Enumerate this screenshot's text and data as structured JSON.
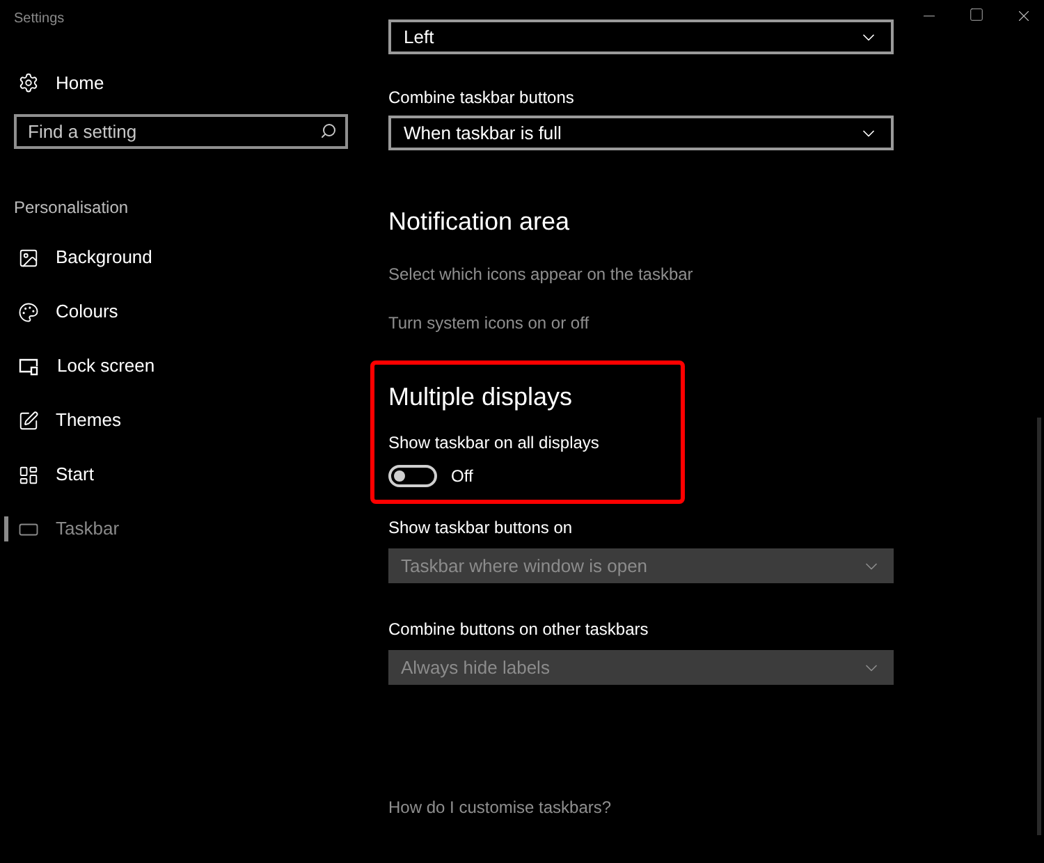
{
  "window": {
    "title": "Settings"
  },
  "sidebar": {
    "home": "Home",
    "search": {
      "placeholder": "Find a setting"
    },
    "section": "Personalisation",
    "items": [
      {
        "label": "Background",
        "kind": "image",
        "selected": false
      },
      {
        "label": "Colours",
        "kind": "palette",
        "selected": false
      },
      {
        "label": "Lock screen",
        "kind": "lock",
        "selected": false
      },
      {
        "label": "Themes",
        "kind": "themes",
        "selected": false
      },
      {
        "label": "Start",
        "kind": "start",
        "selected": false
      },
      {
        "label": "Taskbar",
        "kind": "taskbar",
        "selected": true
      }
    ]
  },
  "content": {
    "top_dropdown": {
      "value": "Left",
      "disabled": false
    },
    "combine": {
      "label": "Combine taskbar buttons",
      "value": "When taskbar is full",
      "disabled": false
    },
    "notification": {
      "heading": "Notification area",
      "links": [
        "Select which icons appear on the taskbar",
        "Turn system icons on or off"
      ]
    },
    "multiple": {
      "heading": "Multiple displays",
      "toggle": {
        "label": "Show taskbar on all displays",
        "on": false,
        "state": "Off"
      },
      "dropdowns": [
        {
          "label": "Show taskbar buttons on",
          "value": "Taskbar where window is open",
          "disabled": true
        },
        {
          "label": "Combine buttons on other taskbars",
          "value": "Always hide labels",
          "disabled": true
        }
      ]
    },
    "help": "How do I customise taskbars?"
  }
}
